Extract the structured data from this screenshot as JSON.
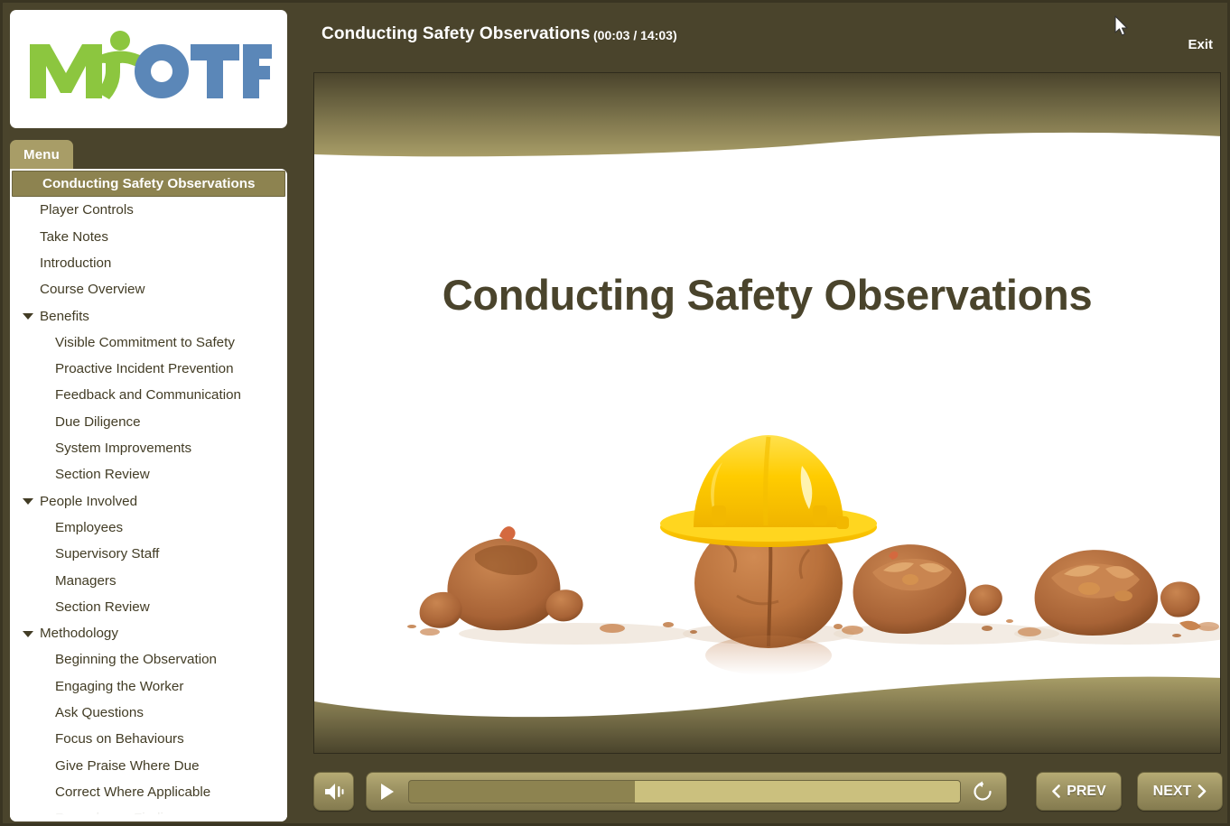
{
  "window": {
    "background_color": "#4a442c",
    "accent_color": "#8d8350",
    "khaki_color": "#a89d67"
  },
  "logo": {
    "name": "myotf-logo",
    "text_green": "MY",
    "text_blue": "OTF",
    "green": "#8cc63f",
    "blue": "#5b87b8"
  },
  "sidebar": {
    "menu_tab_label": "Menu",
    "items": [
      {
        "label": "Conducting Safety Observations",
        "level": 0,
        "selected": true,
        "caret": false
      },
      {
        "label": "Player Controls",
        "level": 0,
        "selected": false,
        "caret": false
      },
      {
        "label": "Take Notes",
        "level": 0,
        "selected": false,
        "caret": false
      },
      {
        "label": "Introduction",
        "level": 0,
        "selected": false,
        "caret": false
      },
      {
        "label": "Course Overview",
        "level": 0,
        "selected": false,
        "caret": false
      },
      {
        "label": "Benefits",
        "level": 0,
        "selected": false,
        "caret": true
      },
      {
        "label": "Visible Commitment to Safety",
        "level": 1,
        "selected": false,
        "caret": false
      },
      {
        "label": "Proactive Incident Prevention",
        "level": 1,
        "selected": false,
        "caret": false
      },
      {
        "label": "Feedback and Communication",
        "level": 1,
        "selected": false,
        "caret": false
      },
      {
        "label": "Due Diligence",
        "level": 1,
        "selected": false,
        "caret": false
      },
      {
        "label": "System Improvements",
        "level": 1,
        "selected": false,
        "caret": false
      },
      {
        "label": "Section Review",
        "level": 1,
        "selected": false,
        "caret": false
      },
      {
        "label": "People Involved",
        "level": 0,
        "selected": false,
        "caret": true
      },
      {
        "label": "Employees",
        "level": 1,
        "selected": false,
        "caret": false
      },
      {
        "label": "Supervisory Staff",
        "level": 1,
        "selected": false,
        "caret": false
      },
      {
        "label": "Managers",
        "level": 1,
        "selected": false,
        "caret": false
      },
      {
        "label": "Section Review",
        "level": 1,
        "selected": false,
        "caret": false
      },
      {
        "label": "Methodology",
        "level": 0,
        "selected": false,
        "caret": true
      },
      {
        "label": "Beginning the Observation",
        "level": 1,
        "selected": false,
        "caret": false
      },
      {
        "label": "Engaging the Worker",
        "level": 1,
        "selected": false,
        "caret": false
      },
      {
        "label": "Ask Questions",
        "level": 1,
        "selected": false,
        "caret": false
      },
      {
        "label": "Focus on Behaviours",
        "level": 1,
        "selected": false,
        "caret": false
      },
      {
        "label": "Give Praise Where Due",
        "level": 1,
        "selected": false,
        "caret": false
      },
      {
        "label": "Correct Where Applicable",
        "level": 1,
        "selected": false,
        "caret": false
      },
      {
        "label": "Record your Findings",
        "level": 1,
        "selected": false,
        "caret": false
      }
    ]
  },
  "header": {
    "course_title": "Conducting Safety Observations",
    "time_display": "(00:03 / 14:03)",
    "elapsed": "00:03",
    "duration": "14:03",
    "exit_label": "Exit"
  },
  "slide": {
    "title": "Conducting Safety Observations",
    "title_color": "#4a442c",
    "artwork_description": "yellow hard hat resting on a whole walnut surrounded by cracked walnut shells",
    "hard_hat_color": "#ffd11a"
  },
  "controls": {
    "volume_icon": "speaker-icon",
    "play_icon": "play-icon",
    "replay_icon": "replay-icon",
    "prev_label": "PREV",
    "next_label": "NEXT",
    "seek_progress_percent": 41
  }
}
